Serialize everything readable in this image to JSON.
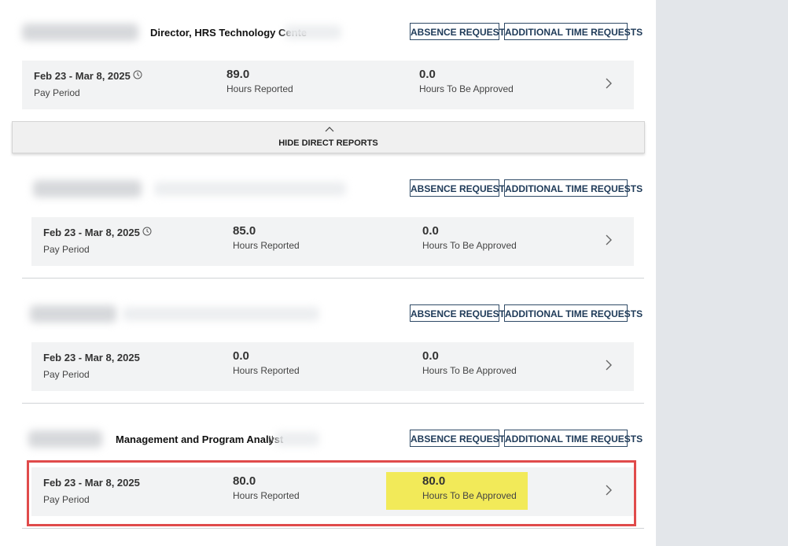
{
  "manager": {
    "title": "Director, HRS Technology Cente",
    "absence_label": "ABSENCE REQUESTS",
    "additional_label": "ADDITIONAL TIME REQUESTS",
    "period": "Feb 23 - Mar 8, 2025",
    "period_label": "Pay Period",
    "hours_reported": "89.0",
    "hours_reported_label": "Hours Reported",
    "hours_to_approve": "0.0",
    "hours_to_approve_label": "Hours To Be Approved"
  },
  "hide_direct_reports_label": "HIDE DIRECT REPORTS",
  "reports": [
    {
      "title": "",
      "absence_label": "ABSENCE REQUESTS",
      "additional_label": "ADDITIONAL TIME REQUESTS",
      "period": "Feb 23 - Mar 8, 2025",
      "period_label": "Pay Period",
      "hours_reported": "85.0",
      "hours_reported_label": "Hours Reported",
      "hours_to_approve": "0.0",
      "hours_to_approve_label": "Hours To Be Approved"
    },
    {
      "title": "",
      "absence_label": "ABSENCE REQUESTS",
      "additional_label": "ADDITIONAL TIME REQUESTS",
      "period": "Feb 23 - Mar 8, 2025",
      "period_label": "Pay Period",
      "hours_reported": "0.0",
      "hours_reported_label": "Hours Reported",
      "hours_to_approve": "0.0",
      "hours_to_approve_label": "Hours To Be Approved"
    },
    {
      "title": "Management and Program Analyst",
      "title_suffix": "II",
      "absence_label": "ABSENCE REQUESTS",
      "additional_label": "ADDITIONAL TIME REQUESTS",
      "period": "Feb 23 - Mar 8, 2025",
      "period_label": "Pay Period",
      "hours_reported": "80.0",
      "hours_reported_label": "Hours Reported",
      "hours_to_approve": "80.0",
      "hours_to_approve_label": "Hours To Be Approved"
    }
  ],
  "colors": {
    "button_border": "#2f4a66",
    "card_bg": "#f2f3f4",
    "highlight": "#f2ea59",
    "annotation_box": "#e04b4b",
    "right_panel": "#e3e6ea"
  },
  "icons": {
    "clock": "clock-icon",
    "chevron_right": "chevron-right-icon",
    "chevron_up": "chevron-up-icon"
  }
}
